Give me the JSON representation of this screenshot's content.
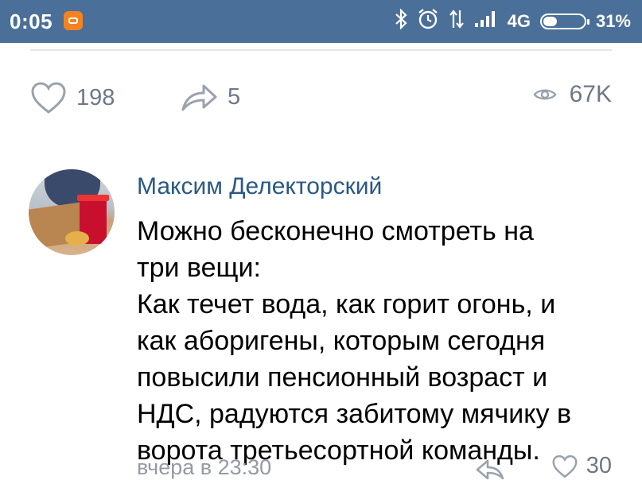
{
  "status_bar": {
    "time": "0:05",
    "network_type": "4G",
    "battery_percent": "31%",
    "battery_level": 0.31,
    "icons": [
      "bluetooth-icon",
      "alarm-icon",
      "data-arrows-icon",
      "signal-icon",
      "battery-icon"
    ]
  },
  "post": {
    "likes_count": "198",
    "shares_count": "5",
    "views_count": "67K"
  },
  "comment": {
    "author": "Максим Делекторский",
    "text": "Можно бесконечно смотреть на\nтри вещи:\nКак течет вода, как горит огонь, и\nкак аборигены, которым сегодня\nповысили пенсионный возраст и\nНДС, радуются забитому мячику в\nворота третьесортной команды.",
    "timestamp": "вчера в 23:30",
    "likes_count": "30"
  },
  "colors": {
    "status_bar": "#4a6f98",
    "author_link": "#2a5885",
    "secondary_text": "#6d7885",
    "timestamp": "#939aa3",
    "notification_badge": "#f58220"
  }
}
